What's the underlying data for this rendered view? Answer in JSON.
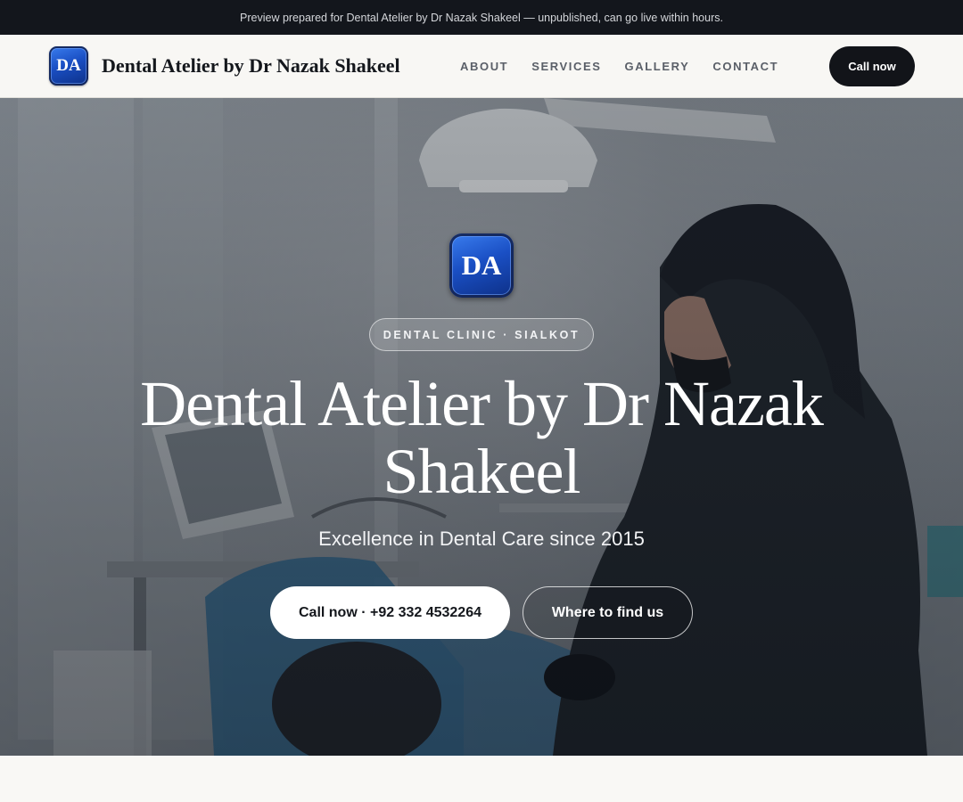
{
  "preview_bar": {
    "text": "Preview prepared for Dental Atelier by Dr Nazak Shakeel — unpublished, can go live within hours."
  },
  "header": {
    "logo_initials": "DA",
    "brand_name": "Dental Atelier by Dr Nazak Shakeel",
    "nav": [
      {
        "label": "ABOUT"
      },
      {
        "label": "SERVICES"
      },
      {
        "label": "GALLERY"
      },
      {
        "label": "CONTACT"
      }
    ],
    "cta_label": "Call now"
  },
  "hero": {
    "badge_initials": "DA",
    "pill_text": "DENTAL CLINIC · SIALKOT",
    "title": "Dental Atelier by Dr Nazak Shakeel",
    "subtitle": "Excellence in Dental Care since 2015",
    "primary_button": "Call now · +92 332 4532264",
    "secondary_button": "Where to find us",
    "background_image": "dentist-treating-patient-photo"
  },
  "colors": {
    "top_bar": "#13161c",
    "header_bg": "#f8f7f4",
    "brand_blue": "#1a4fc4",
    "cta_dark": "#121419",
    "page_bg": "#f9f8f5"
  }
}
